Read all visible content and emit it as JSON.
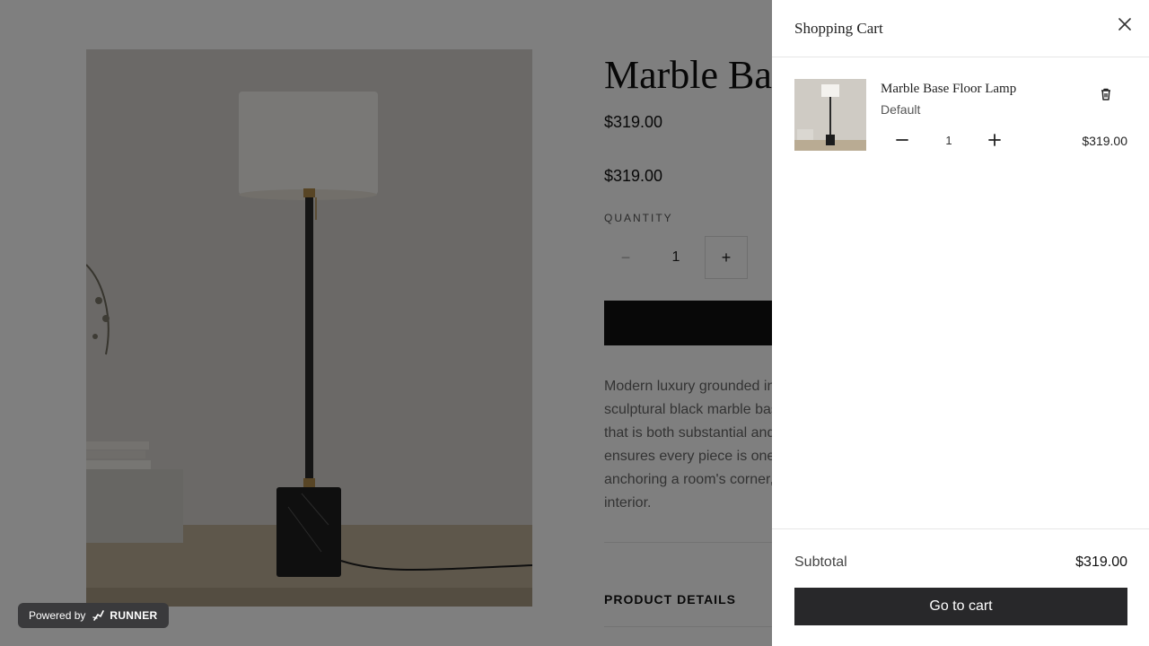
{
  "product": {
    "title": "Marble Base Floor Lamp",
    "price": "$319.00",
    "price_secondary": "$319.00",
    "quantity_label": "QUANTITY",
    "quantity_minus": "−",
    "quantity": "1",
    "quantity_plus": "+",
    "description_lines": [
      "Modern luxury grounded in natural materials. The",
      "sculptural black marble base supports a brass stem",
      "that is both substantial and refined; the stone veining",
      "ensures every piece is one of a kind. Perfect for",
      "anchoring a room's corner, reading nook, or modern",
      "interior."
    ],
    "details_toggle": "PRODUCT DETAILS"
  },
  "badge": {
    "powered_by": "Powered by",
    "brand": "RUNNER"
  },
  "cart": {
    "title": "Shopping Cart",
    "items": [
      {
        "name": "Marble Base Floor Lamp",
        "variant": "Default",
        "quantity": "1",
        "price": "$319.00"
      }
    ],
    "subtotal_label": "Subtotal",
    "subtotal_value": "$319.00",
    "checkout_label": "Go to cart"
  },
  "colors": {
    "overlay": "rgba(0,0,0,0.5)",
    "button_dark": "#28282a",
    "badge_bg": "#3a3a3c"
  }
}
